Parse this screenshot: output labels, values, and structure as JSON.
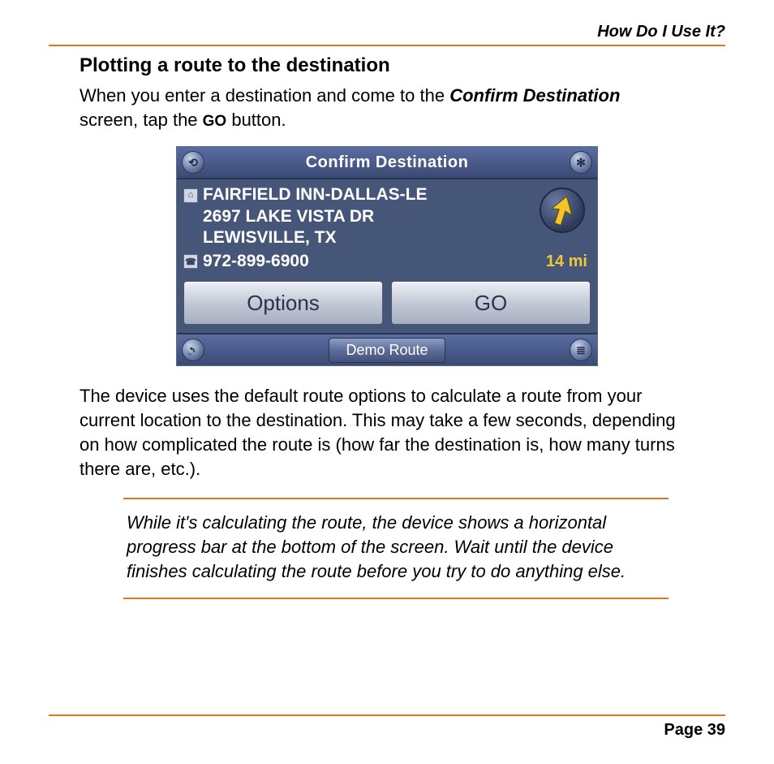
{
  "header": {
    "section_label": "How Do I Use It?"
  },
  "page": {
    "title": "Plotting a route to the destination",
    "intro_pre": "When you enter a destination and come to the ",
    "intro_bolditalic": "Confirm Destination",
    "intro_mid": " screen, tap the ",
    "intro_go": "GO",
    "intro_post": " button.",
    "para2": "The device uses the default route options to calculate a route from your current location to the destination. This may take a few seconds, depending on how complicated the route is (how far the destination is, how many turns there are, etc.).",
    "note": "While it's calculating the route, the device shows a horizontal progress bar at the bottom of the screen. Wait until the device finishes calculating the route before you try to do anything else."
  },
  "device": {
    "top_bar_title": "Confirm Destination",
    "back_glyph": "⟲",
    "settings_glyph": "✻",
    "speaker_glyph": "🔊",
    "menu_glyph": "≣",
    "destination": {
      "name": "FAIRFIELD INN-DALLAS-LE",
      "street": "2697 LAKE VISTA DR",
      "city": "LEWISVILLE, TX",
      "phone": "972-899-6900",
      "distance": "14 mi"
    },
    "buttons": {
      "options": "Options",
      "go": "GO",
      "demo": "Demo Route"
    }
  },
  "footer": {
    "page_label": "Page 39"
  }
}
